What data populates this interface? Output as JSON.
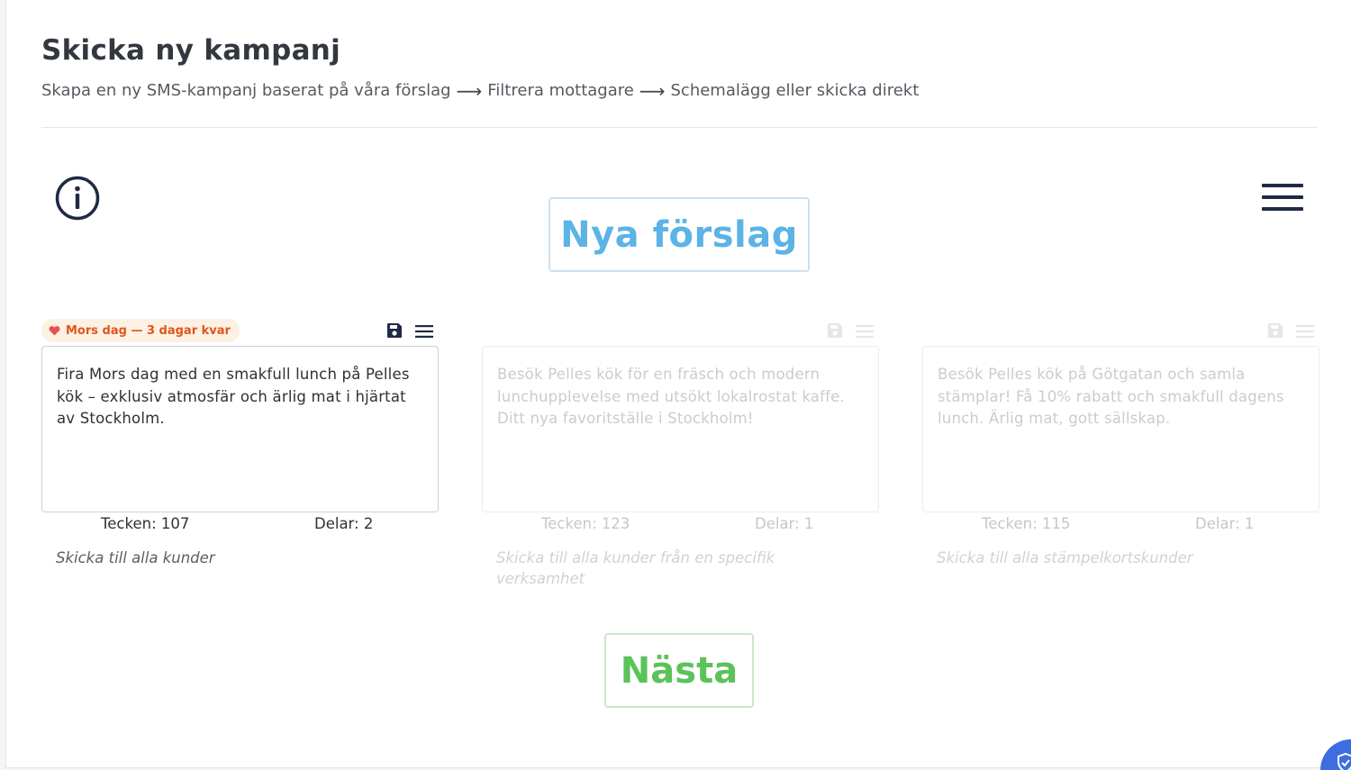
{
  "header": {
    "title": "Skicka ny kampanj",
    "steps": [
      "Skapa en ny SMS-kampanj baserat på våra förslag",
      "Filtrera mottagare",
      "Schemalägg eller skicka direkt"
    ]
  },
  "icons": {
    "info": "info-circle-icon",
    "menu": "hamburger-menu-icon",
    "save": "floppy-disk-icon",
    "list": "list-icon",
    "heart": "heart-icon",
    "help": "shield-check-icon"
  },
  "buttons": {
    "new_suggestions": "Nya förslag",
    "next": "Nästa"
  },
  "cards": [
    {
      "badge": "Mors dag — 3 dagar kvar",
      "text": "Fira Mors dag med en smakfull lunch på Pelles kök – exklusiv atmosfär och ärlig mat i hjärtat av Stockholm.",
      "chars_label": "Tecken: 107",
      "parts_label": "Delar: 2",
      "target": "Skicka till alla kunder",
      "selected": true
    },
    {
      "badge": "",
      "text": "Besök Pelles kök för en fräsch och modern lunchupplevelse med utsökt lokalrostat kaffe. Ditt nya favoritställe i Stockholm!",
      "chars_label": "Tecken: 123",
      "parts_label": "Delar: 1",
      "target": "Skicka till alla kunder från en specifik verksamhet",
      "selected": false
    },
    {
      "badge": "",
      "text": "Besök Pelles kök på Götgatan och samla stämplar! Få 10% rabatt och smakfull dagens lunch. Ärlig mat, gott sällskap.",
      "chars_label": "Tecken: 115",
      "parts_label": "Delar: 1",
      "target": "Skicka till alla stämpelkortskunder",
      "selected": false
    }
  ],
  "colors": {
    "accent_blue": "#5bb3e6",
    "accent_green": "#5cc25a",
    "badge_text": "#e0561b",
    "badge_bg": "#fdf1e3",
    "icon_dark": "#1f2a44"
  }
}
